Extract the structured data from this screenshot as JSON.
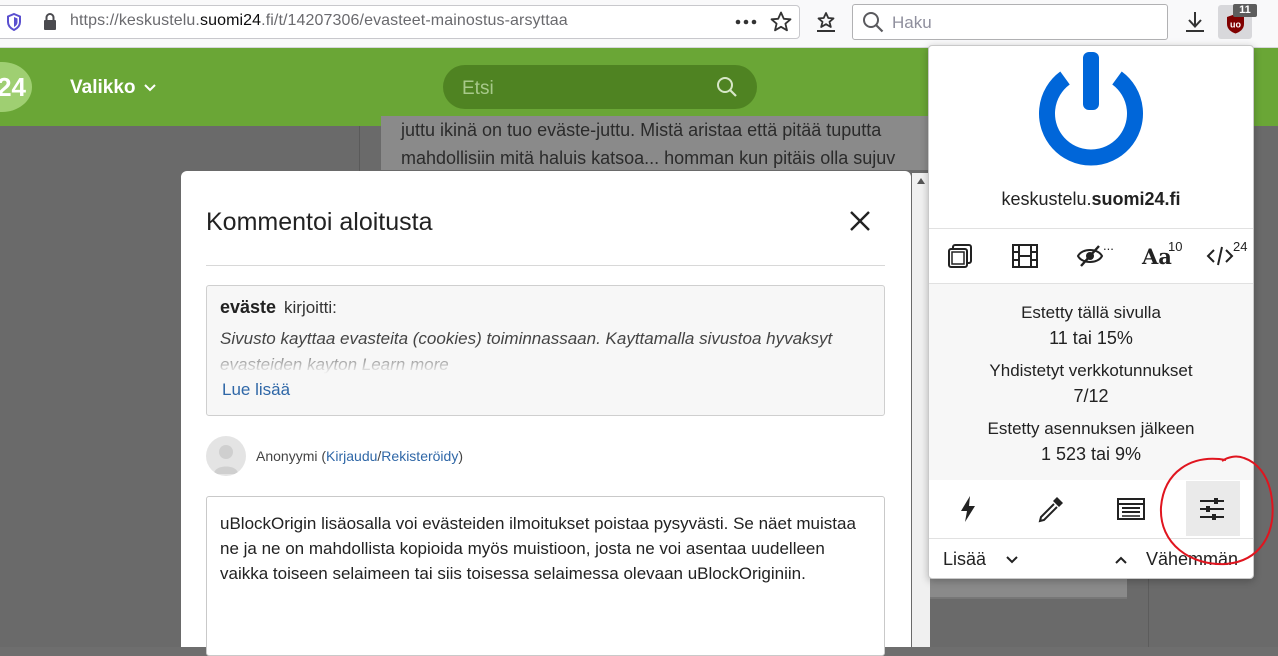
{
  "browser": {
    "url_prefix": "https://keskustelu.",
    "url_domain": "suomi24",
    "url_suffix": ".fi/t/14207306/evasteet-mainostus-arsyttaa",
    "page_actions_icon": "more-dots-icon",
    "search_placeholder": "Haku",
    "ublock_badge": "11"
  },
  "site": {
    "logo": "24",
    "menu_label": "Valikko",
    "search_placeholder": "Etsi",
    "post_text_line1": "juttu ikinä on tuo eväste-juttu. Mistä aristaa että pitää tuputta",
    "post_text_line2": "mahdollisiin mitä haluis katsoa... homman kun pitäis olla sujuv"
  },
  "modal": {
    "title": "Kommentoi aloitusta",
    "quote_author": "eväste",
    "quote_wrote": "kirjoitti:",
    "quote_text": "Sivusto kayttaa evasteita (cookies) toiminnassaan. Kayttamalla sivustoa hyvaksyt evasteiden kayton Learn more",
    "read_more": "Lue lisää",
    "anon_name": "Anonyymi (",
    "login_link": "Kirjaudu",
    "slash": "/",
    "register_link": "Rekisteröidy",
    "close_paren": ")",
    "comment_text": "uBlockOrigin lisäosalla voi evästeiden ilmoitukset poistaa pysyvästi. Se näet muistaa ne ja ne on mahdollista kopioida myös muistioon, josta ne voi asentaa uudelleen vaikka toiseen selaimeen tai siis toisessa selaimessa olevaan uBlockOriginiin."
  },
  "ublock": {
    "domain_sub": "keskustelu.",
    "domain_main": "suomi24.fi",
    "fonts_count": "10",
    "scripts_count": "24",
    "cosmetic_suffix": "...",
    "font_label": "Aa",
    "stats": {
      "blocked_page_label": "Estetty tällä sivulla",
      "blocked_page_value": "11 tai 15%",
      "domains_label": "Yhdistetyt verkkotunnukset",
      "domains_value": "7/12",
      "blocked_total_label": "Estetty asennuksen jälkeen",
      "blocked_total_value": "1 523 tai 9%"
    },
    "more_label": "Lisää",
    "less_label": "Vähemmän",
    "power_color": "#0066d9",
    "annotation_color": "#e0151f"
  }
}
